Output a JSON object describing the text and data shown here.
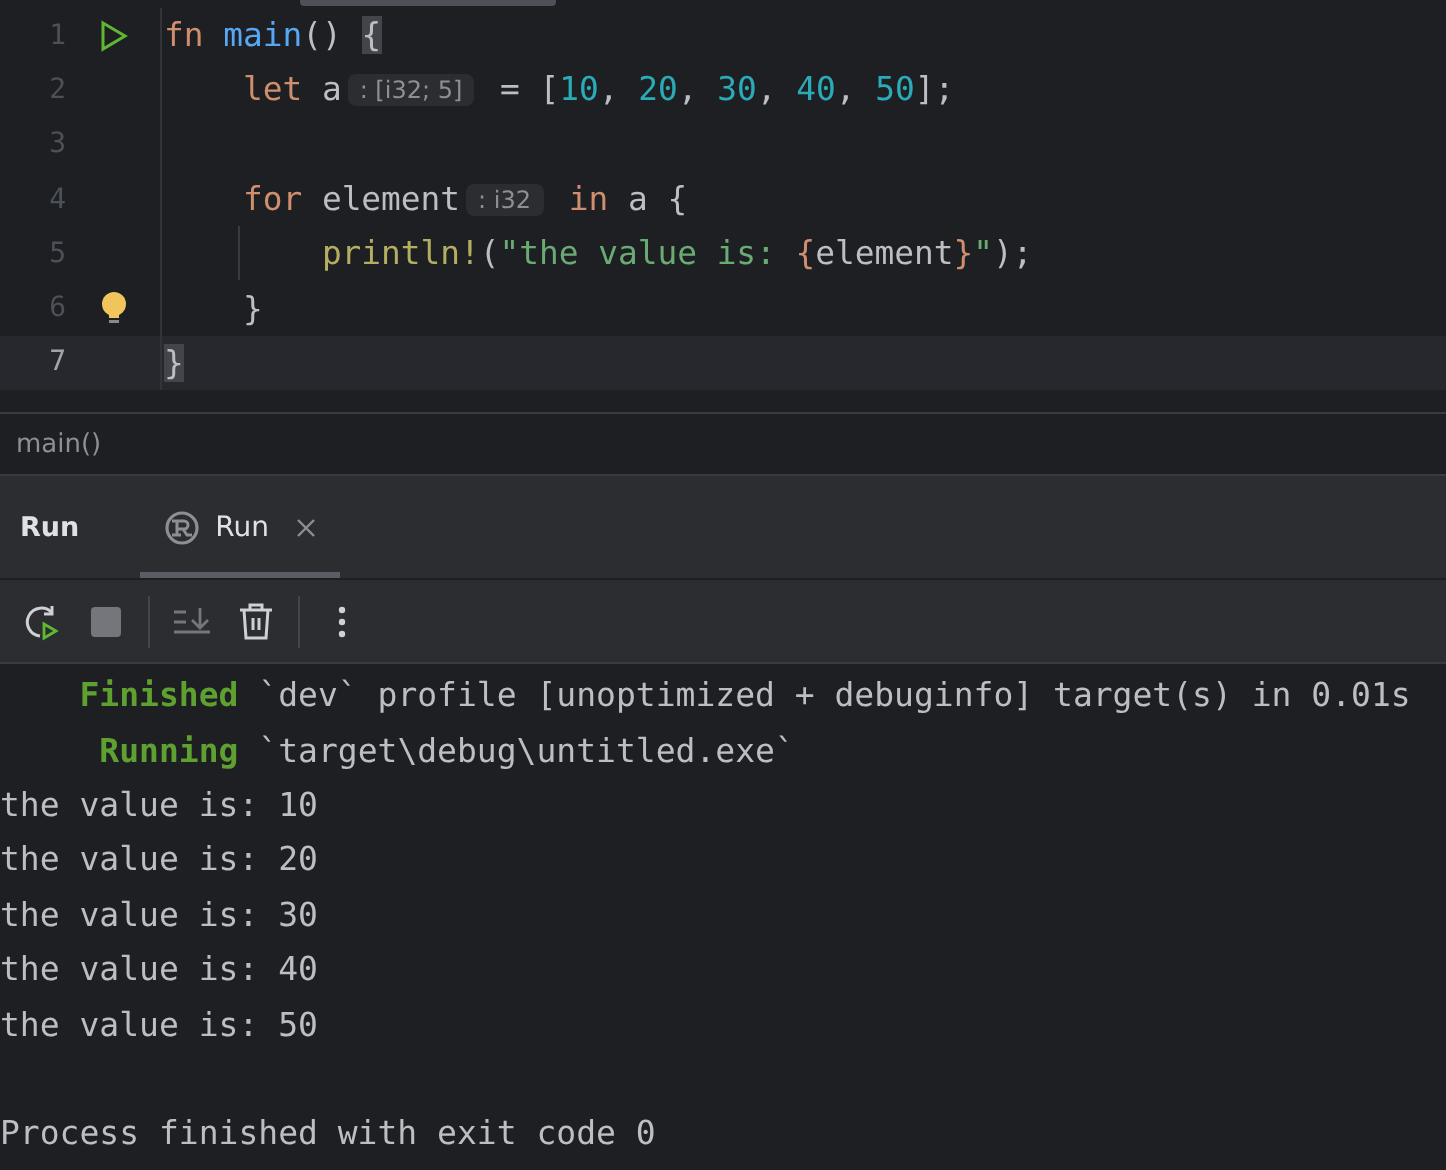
{
  "editor": {
    "lines": [
      {
        "number": "1",
        "run_gutter": true,
        "current": false,
        "bulb": false,
        "tokens": [
          {
            "kind": "keyword",
            "text": "fn"
          },
          {
            "kind": "function",
            "text": " main"
          },
          {
            "kind": "plain",
            "text": "() "
          },
          {
            "kind": "brace_match",
            "text": "{"
          }
        ]
      },
      {
        "number": "2",
        "run_gutter": false,
        "current": false,
        "bulb": false,
        "tokens": [
          {
            "kind": "keyword",
            "text": "    let"
          },
          {
            "kind": "plain",
            "text": " a"
          },
          {
            "kind": "hint",
            "text": ": [i32; 5]"
          },
          {
            "kind": "plain",
            "text": " = ["
          },
          {
            "kind": "number",
            "text": "10"
          },
          {
            "kind": "plain",
            "text": ", "
          },
          {
            "kind": "number",
            "text": "20"
          },
          {
            "kind": "plain",
            "text": ", "
          },
          {
            "kind": "number",
            "text": "30"
          },
          {
            "kind": "plain",
            "text": ", "
          },
          {
            "kind": "number",
            "text": "40"
          },
          {
            "kind": "plain",
            "text": ", "
          },
          {
            "kind": "number",
            "text": "50"
          },
          {
            "kind": "plain",
            "text": "];"
          }
        ]
      },
      {
        "number": "3",
        "run_gutter": false,
        "current": false,
        "bulb": false
      },
      {
        "number": "4",
        "run_gutter": false,
        "current": false,
        "bulb": false,
        "tokens": [
          {
            "kind": "keyword",
            "text": "    for"
          },
          {
            "kind": "plain",
            "text": " element"
          },
          {
            "kind": "hint",
            "text": ": i32"
          },
          {
            "kind": "keyword",
            "text": " in"
          },
          {
            "kind": "plain",
            "text": " a {"
          }
        ]
      },
      {
        "number": "5",
        "run_gutter": false,
        "current": false,
        "bulb": false,
        "tokens": [
          {
            "kind": "macro",
            "text": "        println!"
          },
          {
            "kind": "plain",
            "text": "("
          },
          {
            "kind": "string",
            "text": "\"the value is: "
          },
          {
            "kind": "format",
            "text": "{"
          },
          {
            "kind": "plain",
            "text": "element"
          },
          {
            "kind": "format",
            "text": "}"
          },
          {
            "kind": "string",
            "text": "\""
          },
          {
            "kind": "plain",
            "text": ");"
          }
        ]
      },
      {
        "number": "6",
        "run_gutter": false,
        "current": false,
        "bulb": true,
        "tokens": [
          {
            "kind": "plain",
            "text": "    }"
          }
        ]
      },
      {
        "number": "7",
        "run_gutter": false,
        "current": true,
        "bulb": false,
        "tokens": [
          {
            "kind": "brace_match",
            "text": "}"
          }
        ]
      }
    ]
  },
  "breadcrumb": "main()",
  "tool_window": {
    "title": "Run",
    "tabs": [
      {
        "label": "Run",
        "selected": true,
        "closable": true
      }
    ]
  },
  "toolbar": [
    {
      "kind": "rerun",
      "disabled": false
    },
    {
      "kind": "stop",
      "disabled": true
    },
    {
      "kind": "separator"
    },
    {
      "kind": "scroll_end",
      "disabled": true
    },
    {
      "kind": "clear",
      "disabled": false
    },
    {
      "kind": "separator"
    },
    {
      "kind": "more",
      "disabled": false
    }
  ],
  "console": {
    "lines": [
      {
        "kind": "status",
        "label": "    Finished",
        "text": " `dev` profile [unoptimized + debuginfo] target(s) in 0.01s"
      },
      {
        "kind": "status",
        "label": "     Running",
        "text": " `target\\debug\\untitled.exe`"
      },
      {
        "kind": "output",
        "text": "the value is: 10"
      },
      {
        "kind": "output",
        "text": "the value is: 20"
      },
      {
        "kind": "output",
        "text": "the value is: 30"
      },
      {
        "kind": "output",
        "text": "the value is: 40"
      },
      {
        "kind": "output",
        "text": "the value is: 50"
      },
      {
        "kind": "output"
      },
      {
        "kind": "output",
        "text": "Process finished with exit code 0"
      }
    ]
  }
}
